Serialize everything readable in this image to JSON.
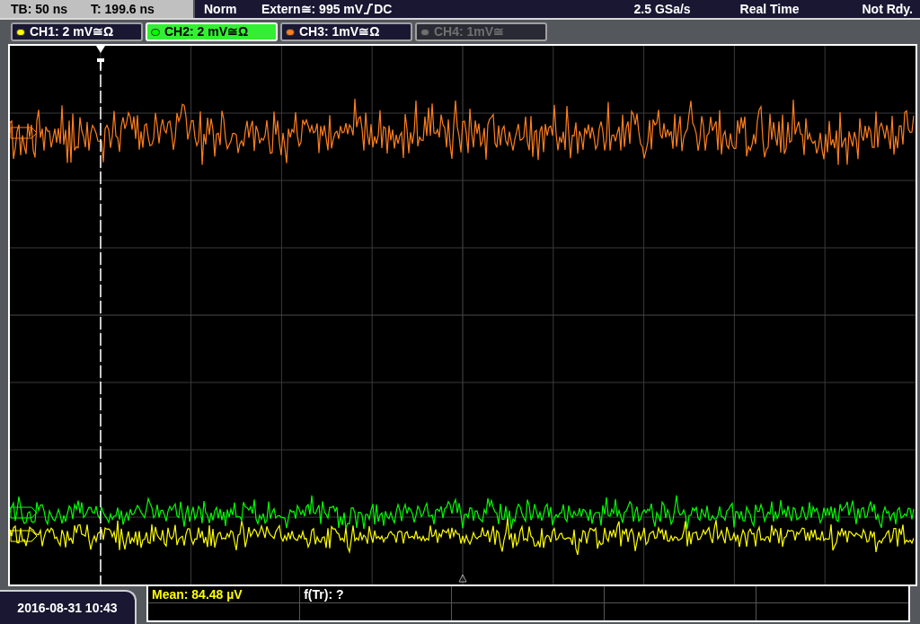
{
  "status_bar": {
    "timebase": "TB: 50 ns",
    "trigger_time": "T: 199.6 ns",
    "trigger_mode": "Norm",
    "trigger_level": "Extern≅: 995 mV",
    "trigger_coupling": "DC",
    "sample_rate": "2.5 GSa/s",
    "acquisition": "Real Time",
    "state": "Not Rdy."
  },
  "channels": [
    {
      "label": "CH1: 2 mV≅Ω",
      "color": "#ffff00",
      "selected": false,
      "on": true
    },
    {
      "label": "CH2: 2 mV≅Ω",
      "color": "#00ff00",
      "selected": true,
      "on": true
    },
    {
      "label": "CH3: 1mV≅Ω",
      "color": "#ff7f1e",
      "selected": false,
      "on": true
    },
    {
      "label": "CH4: 1mV≅",
      "color": "#707070",
      "selected": false,
      "on": false
    }
  ],
  "date": "2016-08-31 10:43",
  "measurements": [
    {
      "text": "Mean: 84.48 µV",
      "kind": "channel"
    },
    {
      "text": "f(Tr): ?",
      "kind": "plain"
    }
  ]
}
